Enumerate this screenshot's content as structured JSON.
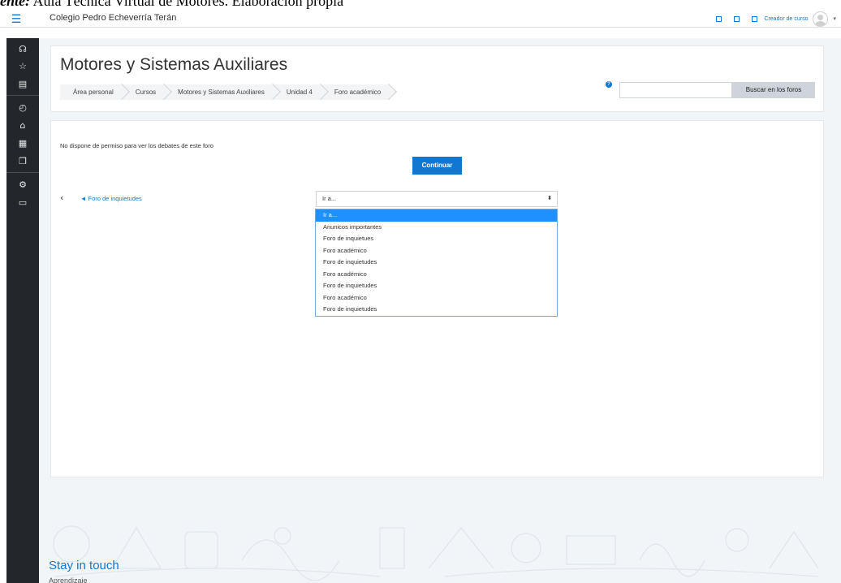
{
  "caption": {
    "prefix": "ente:",
    "text": " Aula Técnica Virtual de Motores. Elaboración propia"
  },
  "navbar": {
    "menu_icon": "☰",
    "site_name": "Colegio Pedro Echeverría Terán",
    "user_role": "Creador de curso",
    "caret": "▾"
  },
  "sidebar": {
    "icons": [
      {
        "name": "graduation-icon",
        "glyph": "☊"
      },
      {
        "name": "star-icon",
        "glyph": "☆"
      },
      {
        "name": "book-icon",
        "glyph": "▤"
      },
      {
        "name": "dashboard-icon",
        "glyph": "◴"
      },
      {
        "name": "home-icon",
        "glyph": "⌂"
      },
      {
        "name": "calendar-icon",
        "glyph": "▦"
      },
      {
        "name": "files-icon",
        "glyph": "❐"
      },
      {
        "name": "gear-icon",
        "glyph": "⚙"
      },
      {
        "name": "folder-icon",
        "glyph": "▭"
      }
    ]
  },
  "header": {
    "title": "Motores y Sistemas Auxiliares",
    "breadcrumb": [
      "Área personal",
      "Cursos",
      "Motores y Sistemas Auxiliares",
      "Unidad 4",
      "Foro académico"
    ],
    "help_glyph": "?",
    "search_placeholder": "",
    "search_button": "Buscar en los foros"
  },
  "main": {
    "permission_message": "No dispone de permiso para ver los debates de este foro",
    "continue_button": "Continuar",
    "prev_arrow": "‹",
    "prev_link": "◄ Foro de inquietudes",
    "jump_select": {
      "selected": "Ir a...",
      "caret": "⬍"
    },
    "jump_options": [
      "Ir a...",
      "Anunicos importantes",
      "Foro de inquietues",
      "Foro académico",
      "Foro de inquietudes",
      "Foro académico",
      "Foro de inquietudes",
      "Foro académico",
      "Foro de inquietudes"
    ]
  },
  "footer": {
    "title": "Stay in touch",
    "subtitle": "Aprendizaje"
  },
  "colors": {
    "accent": "#1177d1",
    "sidebar": "#23272b",
    "page_background": "#f2f5f8"
  }
}
